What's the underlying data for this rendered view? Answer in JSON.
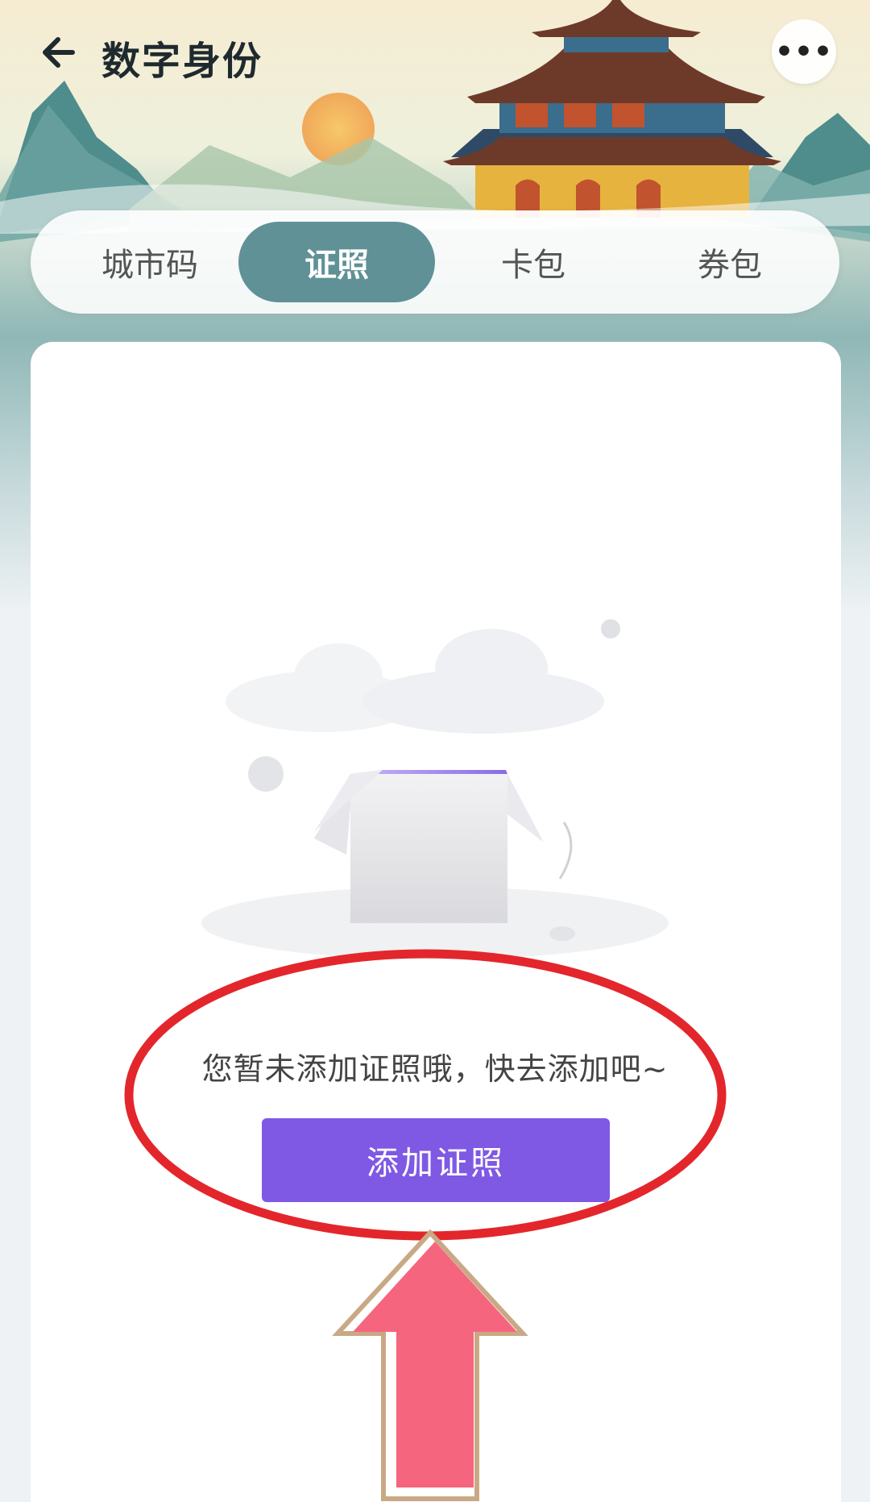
{
  "header": {
    "title": "数字身份",
    "more_label": "•••"
  },
  "tabs": [
    {
      "label": "城市码",
      "active": false
    },
    {
      "label": "证照",
      "active": true
    },
    {
      "label": "卡包",
      "active": false
    },
    {
      "label": "券包",
      "active": false
    }
  ],
  "empty_state": {
    "message": "您暂未添加证照哦，快去添加吧~",
    "button_label": "添加证照"
  },
  "colors": {
    "active_tab": "#5f9196",
    "primary_button": "#7f59e3",
    "annotation_circle": "#e3262b",
    "annotation_arrow": "#f5657e"
  },
  "icons": {
    "back": "arrow-left-icon",
    "more": "more-dots-icon",
    "illustration": "empty-box-illustration"
  }
}
